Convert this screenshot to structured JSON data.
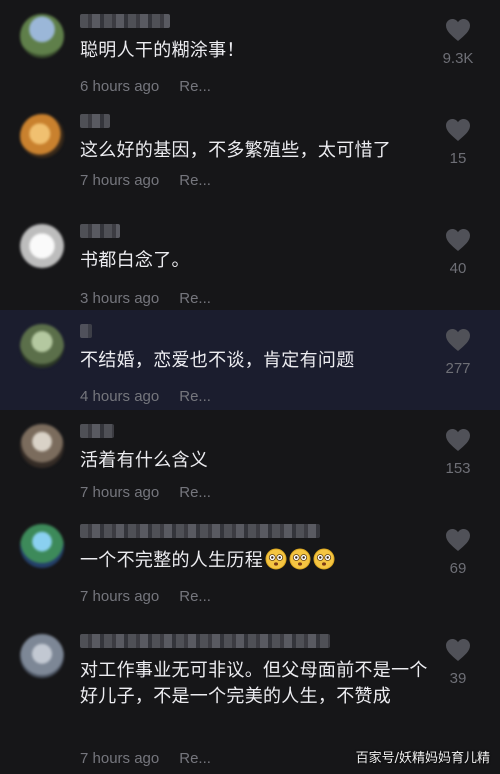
{
  "comments": [
    {
      "text": "聪明人干的糊涂事！",
      "time": "6 hours ago",
      "reply": "Re...",
      "likes": "9.3K",
      "username_hidden": true
    },
    {
      "text": "这么好的基因，不多繁殖些，太可惜了",
      "time": "7 hours ago",
      "reply": "Re...",
      "likes": "15",
      "username_hidden": true
    },
    {
      "text": "书都白念了。",
      "time": "3 hours ago",
      "reply": "Re...",
      "likes": "40",
      "username_hidden": true
    },
    {
      "text": "不结婚，恋爱也不谈，肯定有问题",
      "time": "4 hours ago",
      "reply": "Re...",
      "likes": "277",
      "username_hidden": true,
      "highlighted": true
    },
    {
      "text": "活着有什么含义",
      "time": "7 hours ago",
      "reply": "Re...",
      "likes": "153",
      "username_hidden": true
    },
    {
      "text": "一个不完整的人生历程",
      "emoji_count": 3,
      "time": "7 hours ago",
      "reply": "Re...",
      "likes": "69",
      "username_hidden": true
    },
    {
      "text": "对工作事业无可非议。但父母面前不是一个好儿子，不是一个完美的人生，不赞成",
      "time": "7 hours ago",
      "reply": "Re...",
      "likes": "39",
      "username_hidden": true
    }
  ],
  "icons": {
    "like": "heart-icon",
    "emoji": "flushed-face-emoji"
  },
  "colors": {
    "background": "#141416",
    "highlight_row": "#1b1d2e",
    "text": "#ececf0",
    "meta": "#75767d",
    "heart": "#505158"
  },
  "watermark": "百家号/妖精妈妈育儿精"
}
